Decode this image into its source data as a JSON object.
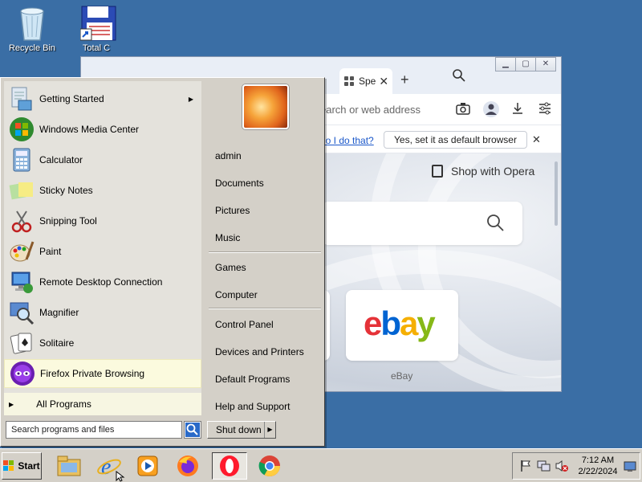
{
  "desktop": {
    "icons": [
      {
        "label": "Recycle Bin",
        "icon": "recycle-bin-icon"
      },
      {
        "label": "Total C",
        "icon": "total-commander-icon"
      }
    ]
  },
  "browser": {
    "tab": {
      "label": "Spe",
      "icon": "speed-dial-icon"
    },
    "address_placeholder": "earch or web address",
    "notification": {
      "link": "do I do that?",
      "button": "Yes, set it as default browser"
    },
    "shop_label": "Shop with Opera",
    "speed_dial": [
      {
        "label": "eBay",
        "logo": "ebay"
      }
    ]
  },
  "start_menu": {
    "programs": [
      {
        "label": "Getting Started",
        "icon": "getting-started-icon",
        "submenu": true
      },
      {
        "label": "Windows Media Center",
        "icon": "media-center-icon"
      },
      {
        "label": "Calculator",
        "icon": "calculator-icon"
      },
      {
        "label": "Sticky Notes",
        "icon": "sticky-notes-icon"
      },
      {
        "label": "Snipping Tool",
        "icon": "snipping-tool-icon"
      },
      {
        "label": "Paint",
        "icon": "paint-icon"
      },
      {
        "label": "Remote Desktop Connection",
        "icon": "remote-desktop-icon"
      },
      {
        "label": "Magnifier",
        "icon": "magnifier-icon"
      },
      {
        "label": "Solitaire",
        "icon": "solitaire-icon"
      },
      {
        "label": "Firefox Private Browsing",
        "icon": "firefox-private-icon",
        "highlighted": true
      }
    ],
    "all_programs": "All Programs",
    "search_placeholder": "Search programs and files",
    "right_items": [
      {
        "label": "admin"
      },
      {
        "label": "Documents"
      },
      {
        "label": "Pictures"
      },
      {
        "label": "Music"
      },
      {
        "label": "Games"
      },
      {
        "label": "Computer"
      },
      {
        "label": "Control Panel"
      },
      {
        "label": "Devices and Printers"
      },
      {
        "label": "Default Programs"
      },
      {
        "label": "Help and Support"
      }
    ],
    "shutdown": "Shut down"
  },
  "taskbar": {
    "start_label": "Start",
    "pinned": [
      {
        "name": "file-explorer-icon"
      },
      {
        "name": "internet-explorer-icon"
      },
      {
        "name": "media-player-icon"
      },
      {
        "name": "firefox-icon"
      },
      {
        "name": "opera-icon",
        "active": true
      },
      {
        "name": "chrome-icon"
      }
    ],
    "clock": {
      "time": "7:12 AM",
      "date": "2/22/2024"
    }
  }
}
